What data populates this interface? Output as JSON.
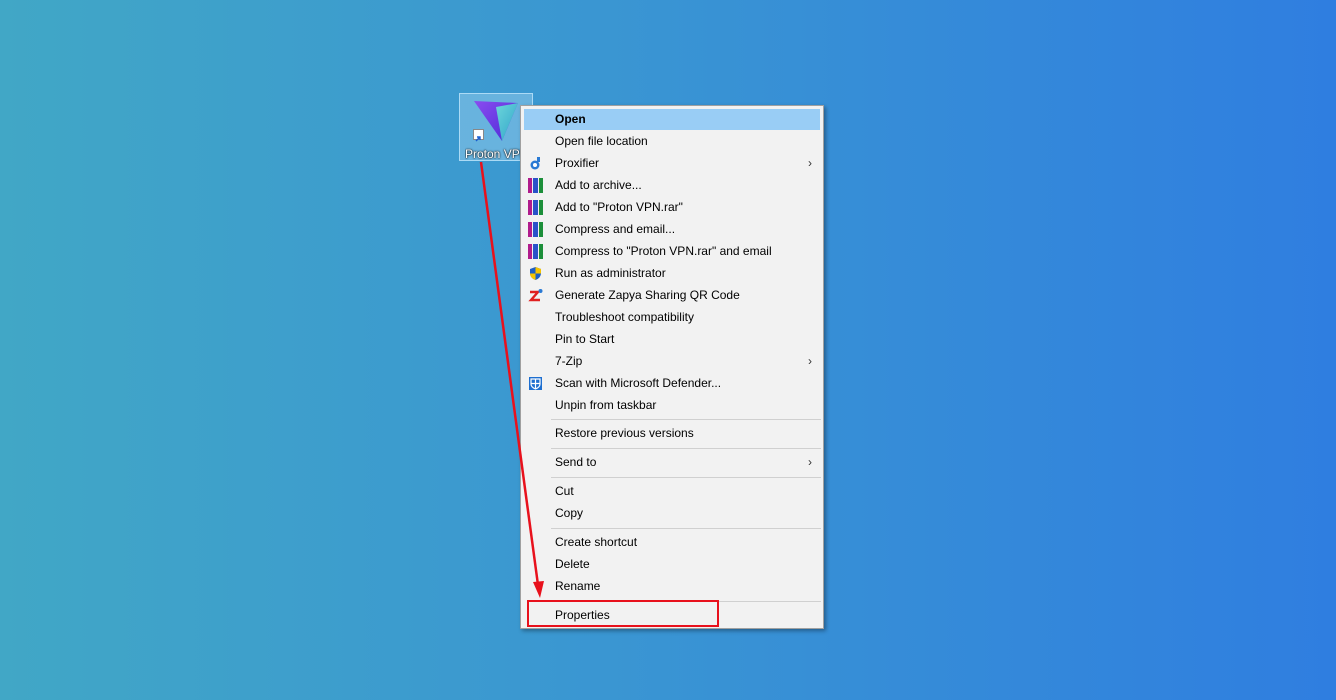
{
  "desktop": {
    "icon_label": "Proton VPN",
    "icon_name": "proton-vpn-logo-icon"
  },
  "menu": {
    "items": [
      {
        "label": "Open",
        "icon": "",
        "submenu": false
      },
      {
        "label": "Open file location",
        "icon": "",
        "submenu": false
      },
      {
        "label": "Proxifier",
        "icon": "proxifier-icon",
        "submenu": true
      },
      {
        "label": "Add to archive...",
        "icon": "winrar-icon",
        "submenu": false
      },
      {
        "label": "Add to \"Proton VPN.rar\"",
        "icon": "winrar-icon",
        "submenu": false
      },
      {
        "label": "Compress and email...",
        "icon": "winrar-icon",
        "submenu": false
      },
      {
        "label": "Compress to \"Proton VPN.rar\" and email",
        "icon": "winrar-icon",
        "submenu": false
      },
      {
        "label": "Run as administrator",
        "icon": "uac-shield-icon",
        "submenu": false
      },
      {
        "label": "Generate Zapya Sharing QR Code",
        "icon": "zapya-icon",
        "submenu": false
      },
      {
        "label": "Troubleshoot compatibility",
        "icon": "",
        "submenu": false
      },
      {
        "label": "Pin to Start",
        "icon": "",
        "submenu": false
      },
      {
        "label": "7-Zip",
        "icon": "",
        "submenu": true
      },
      {
        "label": "Scan with Microsoft Defender...",
        "icon": "defender-icon",
        "submenu": false
      },
      {
        "label": "Unpin from taskbar",
        "icon": "",
        "submenu": false
      },
      {
        "label": "Restore previous versions",
        "icon": "",
        "submenu": false
      },
      {
        "label": "Send to",
        "icon": "",
        "submenu": true
      },
      {
        "label": "Cut",
        "icon": "",
        "submenu": false
      },
      {
        "label": "Copy",
        "icon": "",
        "submenu": false
      },
      {
        "label": "Create shortcut",
        "icon": "",
        "submenu": false
      },
      {
        "label": "Delete",
        "icon": "",
        "submenu": false
      },
      {
        "label": "Rename",
        "icon": "",
        "submenu": false
      },
      {
        "label": "Properties",
        "icon": "",
        "submenu": false
      }
    ],
    "chevron": "›",
    "highlight_color": "#99cdf5"
  },
  "annotation": {
    "color": "#e8111c",
    "target": "Properties"
  }
}
